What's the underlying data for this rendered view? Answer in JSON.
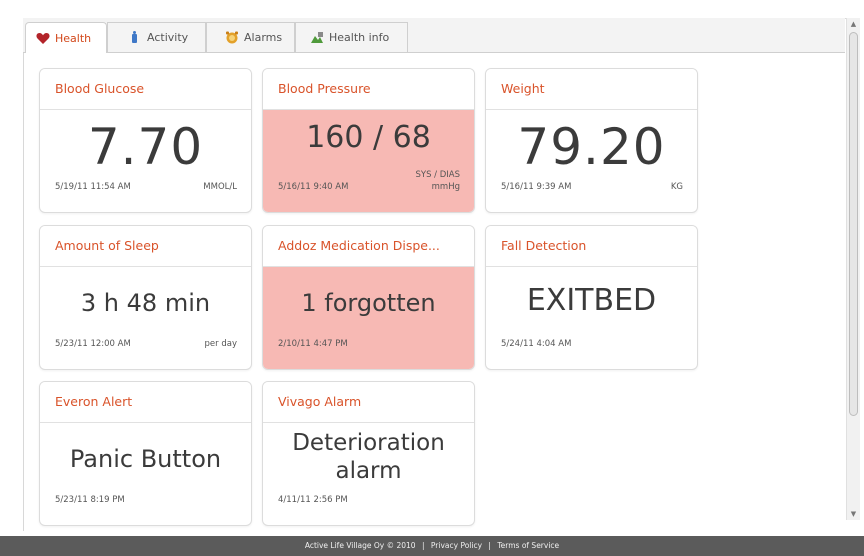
{
  "tabs": [
    {
      "label": "Health",
      "icon": "heart-icon",
      "active": true
    },
    {
      "label": "Activity",
      "icon": "activity-icon",
      "active": false
    },
    {
      "label": "Alarms",
      "icon": "alarm-icon",
      "active": false
    },
    {
      "label": "Health info",
      "icon": "health-info-icon",
      "active": false
    }
  ],
  "tiles": {
    "glucose": {
      "title": "Blood Glucose",
      "value": "7.70",
      "time": "5/19/11 11:54 AM",
      "unit": "MMOL/L"
    },
    "pressure": {
      "title": "Blood Pressure",
      "value": "160 / 68",
      "time": "5/16/11 9:40 AM",
      "unit_top": "SYS / DIAS",
      "unit": "mmHg"
    },
    "weight": {
      "title": "Weight",
      "value": "79.20",
      "time": "5/16/11 9:39 AM",
      "unit": "KG"
    },
    "sleep": {
      "title": "Amount of Sleep",
      "value": "3 h 48 min",
      "time": "5/23/11 12:00 AM",
      "unit": "per day"
    },
    "medication": {
      "title": "Addoz Medication Dispe...",
      "value": "1 forgotten",
      "time": "2/10/11 4:47 PM"
    },
    "fall": {
      "title": "Fall Detection",
      "value": "EXITBED",
      "time": "5/24/11 4:04 AM"
    },
    "everon": {
      "title": "Everon Alert",
      "value": "Panic Button",
      "time": "5/23/11 8:19 PM"
    },
    "vivago": {
      "title": "Vivago Alarm",
      "value": "Deterioration alarm",
      "time": "4/11/11 2:56 PM"
    }
  },
  "colors": {
    "accent": "#d9532a",
    "alert_bg": "#f7b9b4",
    "footer_bg": "#5b5b5b"
  },
  "footer": {
    "copyright": "Active Life Village Oy © 2010",
    "separator": "|",
    "privacy": "Privacy Policy",
    "terms": "Terms of Service"
  }
}
